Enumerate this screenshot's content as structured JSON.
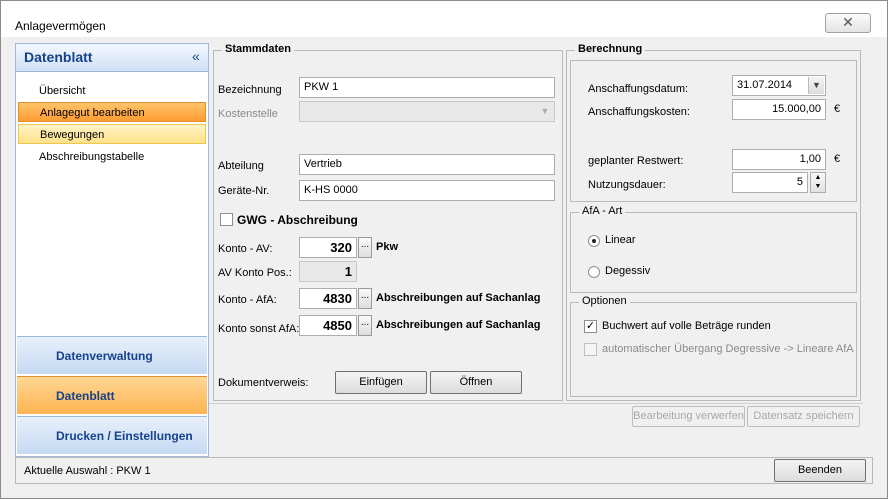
{
  "window": {
    "title": "Anlagevermögen",
    "close_label": "✕"
  },
  "nav": {
    "header": "Datenblatt",
    "collapse_label": "«",
    "items": [
      {
        "label": "Übersicht"
      },
      {
        "label": "Anlagegut bearbeiten"
      },
      {
        "label": "Bewegungen"
      },
      {
        "label": "Abschreibungstabelle"
      }
    ],
    "buttons": [
      {
        "label": "Datenverwaltung"
      },
      {
        "label": "Datenblatt"
      },
      {
        "label": "Drucken / Einstellungen"
      }
    ]
  },
  "stammdaten": {
    "title": "Stammdaten",
    "bezeichnung_label": "Bezeichnung",
    "bezeichnung_value": "PKW 1",
    "kostenstelle_label": "Kostenstelle",
    "kostenstelle_value": "",
    "abteilung_label": "Abteilung",
    "abteilung_value": "Vertrieb",
    "geraete_label": "Geräte-Nr.",
    "geraete_value": "K-HS 0000",
    "gwg_label": "GWG - Abschreibung",
    "gwg_checked": false,
    "konto_av_label": "Konto - AV:",
    "konto_av_value": "320",
    "konto_av_name": "Pkw",
    "av_pos_label": "AV Konto Pos.:",
    "av_pos_value": "1",
    "konto_afa_label": "Konto - AfA:",
    "konto_afa_value": "4830",
    "konto_afa_name": "Abschreibungen auf Sachanlag",
    "konto_sonst_label": "Konto sonst AfA:",
    "konto_sonst_value": "4850",
    "konto_sonst_name": "Abschreibungen auf Sachanlag",
    "lookup_label": "...",
    "dokument_label": "Dokumentverweis:",
    "einfuegen_label": "Einfügen",
    "oeffnen_label": "Öffnen"
  },
  "berechnung": {
    "title": "Berechnung",
    "datum_label": "Anschaffungsdatum:",
    "datum_value": "31.07.2014",
    "kosten_label": "Anschaffungskosten:",
    "kosten_value": "15.000,00",
    "restwert_label": "geplanter Restwert:",
    "restwert_value": "1,00",
    "currency": "€",
    "nutzung_label": "Nutzungsdauer:",
    "nutzung_value": "5"
  },
  "afa_art": {
    "title": "AfA - Art",
    "options": [
      {
        "label": "Linear",
        "selected": true
      },
      {
        "label": "Degessiv",
        "selected": false
      }
    ]
  },
  "optionen": {
    "title": "Optionen",
    "buchwert_label": "Buchwert auf volle Beträge runden",
    "buchwert_checked": true,
    "check_mark": "✓",
    "uebergang_label": "automatischer Übergang Degressive -> Lineare AfA",
    "uebergang_checked": false
  },
  "actions": {
    "bearbeitung_label": "Bearbeitung verwerfen",
    "speichern_label": "Datensatz speichern"
  },
  "status": {
    "text": "Aktuelle Auswahl : PKW 1",
    "beenden_label": "Beenden"
  }
}
